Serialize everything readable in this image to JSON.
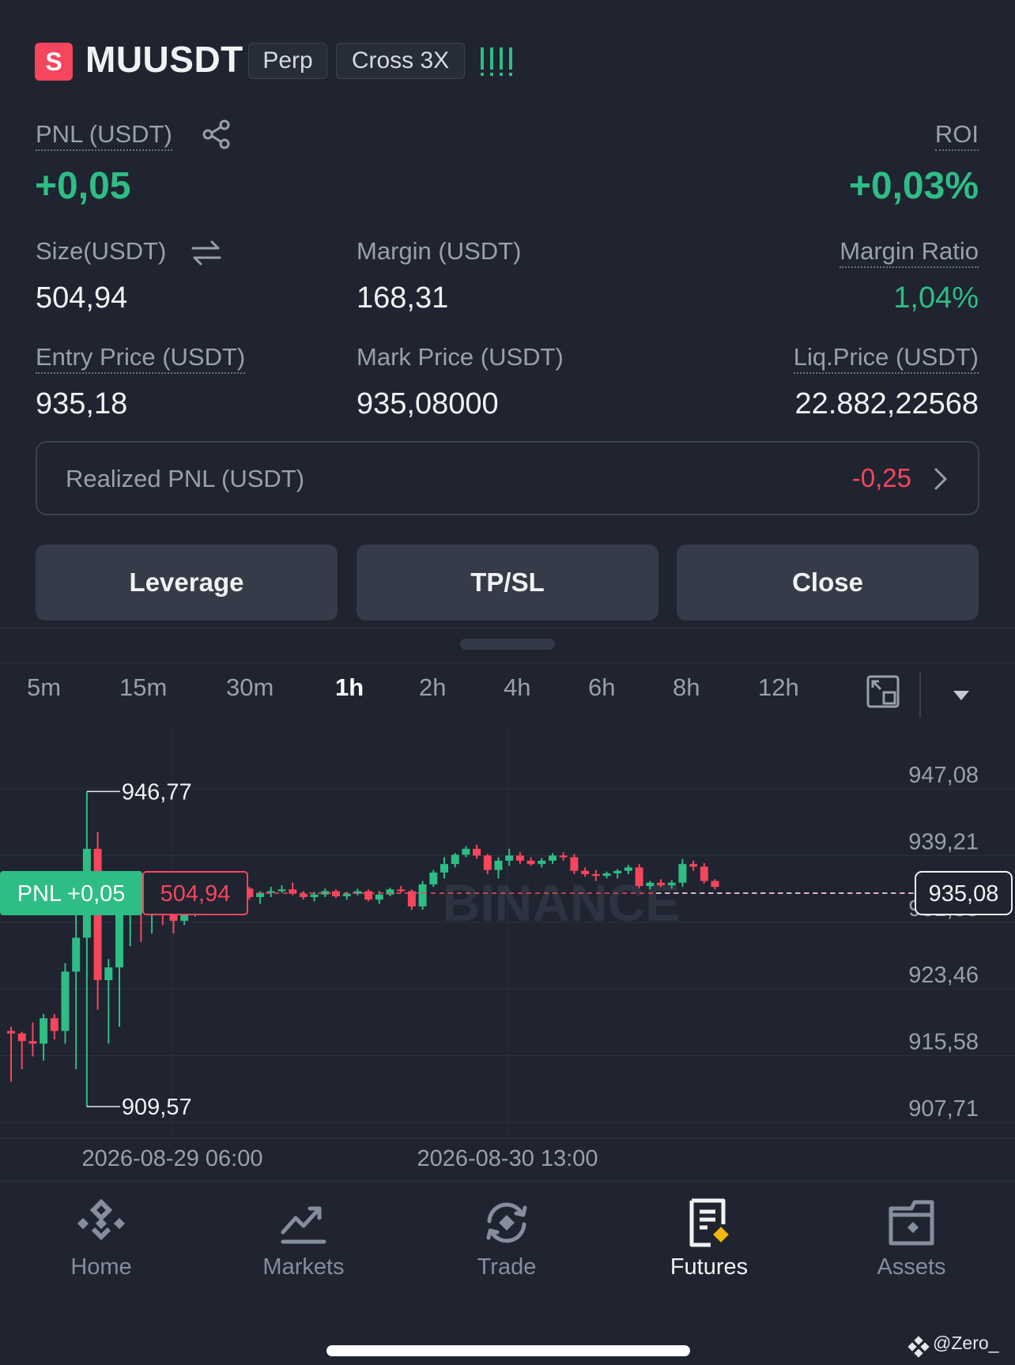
{
  "header": {
    "symbol_icon": "S",
    "symbol": "MUUSDT",
    "tag_perp": "Perp",
    "tag_margin": "Cross 3X",
    "signal_icon": "signal-bars-icon"
  },
  "stats": {
    "pnl_label": "PNL (USDT)",
    "pnl_value": "+0,05",
    "roi_label": "ROI",
    "roi_value": "+0,03%",
    "size_label": "Size(USDT)",
    "size_value": "504,94",
    "margin_label": "Margin (USDT)",
    "margin_value": "168,31",
    "margin_ratio_label": "Margin Ratio",
    "margin_ratio_value": "1,04%",
    "entry_label": "Entry Price (USDT)",
    "entry_value": "935,18",
    "mark_label": "Mark Price (USDT)",
    "mark_value": "935,08000",
    "liq_label": "Liq.Price (USDT)",
    "liq_value": "22.882,22568"
  },
  "realized": {
    "label": "Realized PNL (USDT)",
    "value": "-0,25"
  },
  "actions": {
    "leverage": "Leverage",
    "tpsl": "TP/SL",
    "close": "Close"
  },
  "timeframes": {
    "items": [
      "5m",
      "15m",
      "30m",
      "1h",
      "2h",
      "4h",
      "6h",
      "8h",
      "12h"
    ],
    "active": "1h"
  },
  "chart_data": {
    "type": "candlestick",
    "y_ticks": [
      "947,08",
      "939,21",
      "931,33",
      "923,46",
      "915,58",
      "907,71"
    ],
    "x_ticks": [
      "2026-08-29 06:00",
      "2026-08-30 13:00"
    ],
    "high_label": "946,77",
    "low_label": "909,57",
    "current_price": "935,08",
    "pnl_tag": "PNL +0,05",
    "size_tag": "504,94",
    "watermark": "BINANCE",
    "ylim": [
      907.71,
      947.08
    ],
    "colors": {
      "up": "#2ebd85",
      "down": "#f6465d"
    },
    "candles": [
      [
        918.5,
        919.0,
        912.5,
        918.2
      ],
      [
        918.2,
        918.4,
        914.0,
        917.3
      ],
      [
        917.3,
        919.5,
        915.5,
        917.0
      ],
      [
        917.0,
        920.5,
        915.0,
        920.0
      ],
      [
        920.0,
        920.5,
        917.5,
        918.5
      ],
      [
        918.5,
        926.5,
        917.0,
        925.5
      ],
      [
        925.5,
        933.0,
        914.0,
        929.5
      ],
      [
        929.5,
        946.77,
        909.57,
        940.0
      ],
      [
        940.0,
        942.0,
        921.0,
        924.5
      ],
      [
        924.5,
        927.0,
        917.0,
        926.0
      ],
      [
        926.0,
        934.0,
        919.0,
        933.0
      ],
      [
        933.0,
        936.0,
        928.5,
        934.8
      ],
      [
        934.8,
        935.5,
        929.0,
        932.5
      ],
      [
        932.5,
        936.5,
        930.0,
        936.0
      ],
      [
        936.0,
        936.5,
        931.0,
        933.5
      ],
      [
        933.5,
        934.0,
        930.0,
        931.5
      ],
      [
        931.5,
        934.0,
        931.0,
        933.5
      ],
      [
        933.5,
        934.5,
        932.0,
        934.0
      ],
      [
        934.0,
        934.5,
        932.5,
        933.5
      ],
      [
        933.5,
        935.5,
        933.0,
        935.0
      ],
      [
        935.0,
        935.5,
        933.5,
        934.5
      ],
      [
        934.5,
        935.5,
        934.0,
        935.3
      ],
      [
        935.3,
        935.5,
        934.0,
        934.3
      ],
      [
        934.3,
        935.0,
        933.5,
        934.8
      ],
      [
        934.8,
        935.5,
        934.3,
        935.0
      ],
      [
        935.0,
        935.7,
        934.8,
        935.2
      ],
      [
        935.2,
        936.0,
        934.5,
        934.7
      ],
      [
        934.7,
        935.0,
        934.0,
        934.3
      ],
      [
        934.3,
        934.9,
        933.8,
        934.6
      ],
      [
        934.6,
        935.3,
        934.3,
        935.0
      ],
      [
        935.0,
        935.2,
        934.2,
        934.4
      ],
      [
        934.4,
        934.9,
        934.0,
        934.7
      ],
      [
        934.7,
        935.3,
        934.5,
        935.0
      ],
      [
        935.0,
        935.2,
        933.8,
        934.0
      ],
      [
        934.0,
        935.0,
        933.5,
        934.6
      ],
      [
        934.6,
        935.4,
        934.4,
        935.2
      ],
      [
        935.2,
        935.6,
        934.8,
        935.0
      ],
      [
        935.0,
        935.2,
        932.8,
        933.2
      ],
      [
        933.2,
        936.2,
        932.8,
        935.8
      ],
      [
        935.8,
        937.5,
        935.5,
        937.2
      ],
      [
        937.2,
        939.0,
        936.5,
        938.2
      ],
      [
        938.2,
        939.5,
        937.8,
        939.3
      ],
      [
        939.3,
        940.3,
        939.0,
        940.0
      ],
      [
        940.0,
        940.5,
        938.8,
        939.2
      ],
      [
        939.2,
        939.4,
        937.0,
        937.5
      ],
      [
        937.5,
        939.0,
        936.5,
        938.6
      ],
      [
        938.6,
        940.0,
        938.0,
        939.2
      ],
      [
        939.2,
        939.6,
        938.2,
        938.6
      ],
      [
        938.6,
        939.0,
        938.0,
        938.2
      ],
      [
        938.2,
        938.9,
        937.8,
        938.6
      ],
      [
        938.6,
        939.5,
        938.2,
        939.2
      ],
      [
        939.2,
        939.6,
        938.6,
        939.0
      ],
      [
        939.0,
        939.4,
        937.0,
        937.4
      ],
      [
        937.4,
        937.8,
        936.7,
        937.0
      ],
      [
        937.0,
        937.5,
        936.2,
        936.8
      ],
      [
        936.8,
        937.3,
        936.5,
        937.1
      ],
      [
        937.1,
        937.6,
        936.5,
        937.4
      ],
      [
        937.4,
        938.1,
        937.0,
        937.8
      ],
      [
        937.8,
        938.2,
        935.3,
        935.6
      ],
      [
        935.6,
        936.2,
        935.2,
        936.0
      ],
      [
        936.0,
        936.4,
        935.5,
        935.7
      ],
      [
        935.7,
        936.3,
        935.3,
        936.0
      ],
      [
        936.0,
        938.8,
        935.5,
        938.2
      ],
      [
        938.2,
        938.6,
        937.4,
        937.9
      ],
      [
        937.9,
        938.3,
        935.9,
        936.2
      ],
      [
        936.2,
        936.4,
        935.2,
        935.5
      ]
    ]
  },
  "nav": {
    "home": "Home",
    "markets": "Markets",
    "trade": "Trade",
    "futures": "Futures",
    "assets": "Assets"
  },
  "watermark_user": "@Zero_"
}
